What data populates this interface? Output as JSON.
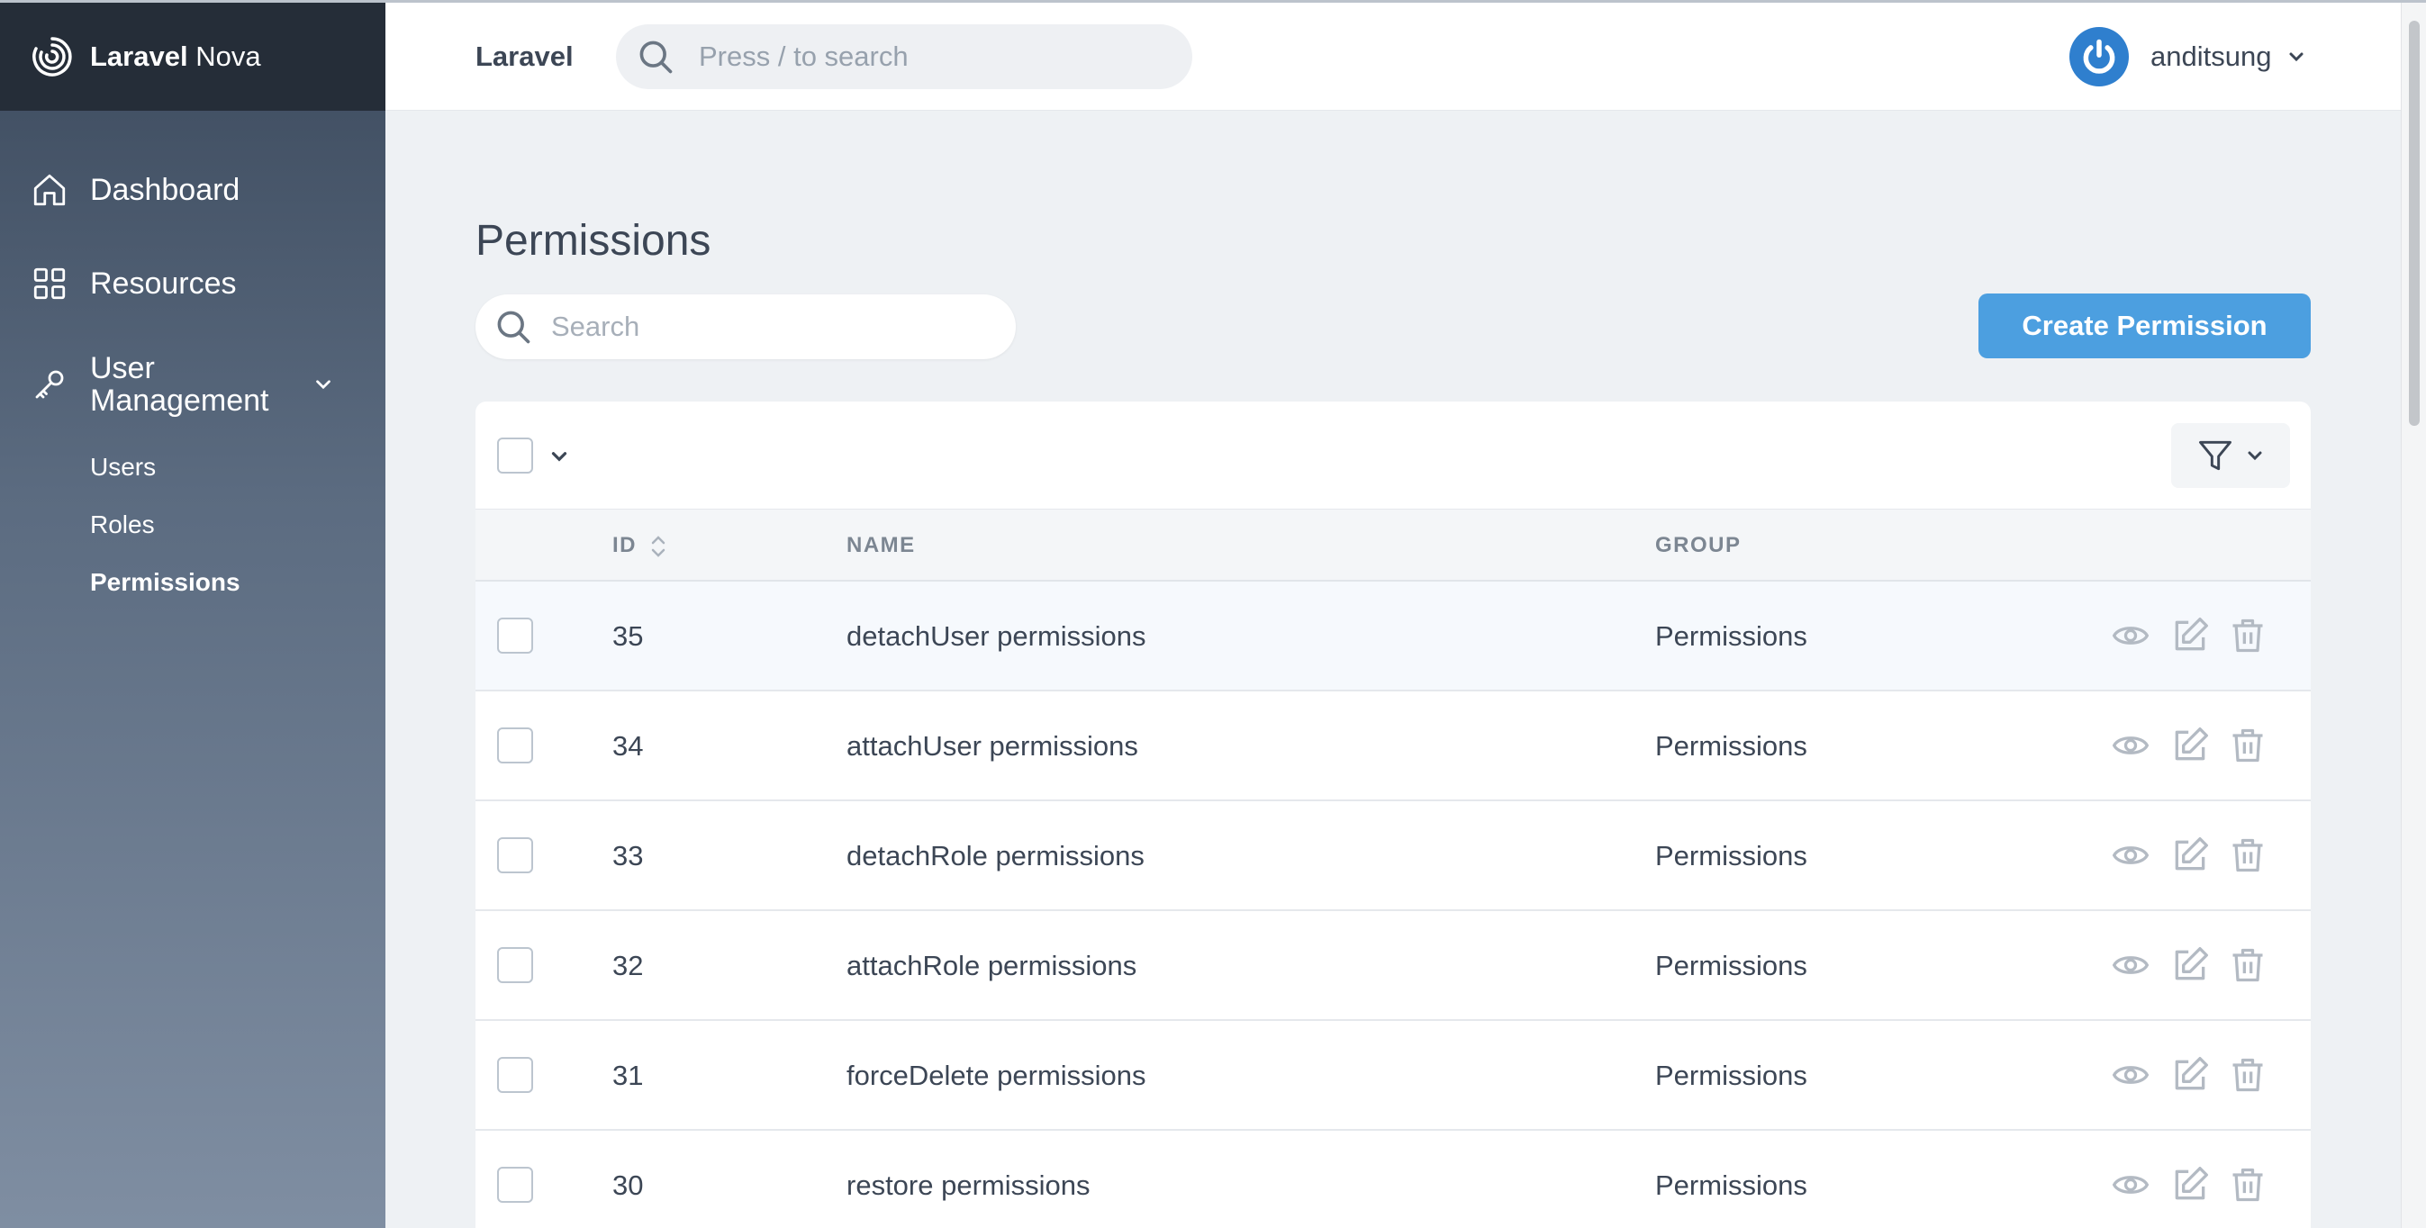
{
  "app": {
    "brand_bold": "Laravel",
    "brand_rest": " Nova"
  },
  "sidebar": {
    "items": [
      {
        "label": "Dashboard",
        "icon": "home-icon"
      },
      {
        "label": "Resources",
        "icon": "grid-icon"
      },
      {
        "label": "User Management",
        "icon": "key-icon"
      }
    ],
    "sub_items": [
      {
        "label": "Users",
        "active": false
      },
      {
        "label": "Roles",
        "active": false
      },
      {
        "label": "Permissions",
        "active": true
      }
    ]
  },
  "header": {
    "title": "Laravel",
    "search_placeholder": "Press / to search",
    "username": "anditsung"
  },
  "main": {
    "page_title": "Permissions",
    "search_placeholder": "Search",
    "create_button": "Create Permission",
    "columns": {
      "id": "ID",
      "name": "NAME",
      "group": "GROUP"
    },
    "rows": [
      {
        "id": "35",
        "name": "detachUser permissions",
        "group": "Permissions"
      },
      {
        "id": "34",
        "name": "attachUser permissions",
        "group": "Permissions"
      },
      {
        "id": "33",
        "name": "detachRole permissions",
        "group": "Permissions"
      },
      {
        "id": "32",
        "name": "attachRole permissions",
        "group": "Permissions"
      },
      {
        "id": "31",
        "name": "forceDelete permissions",
        "group": "Permissions"
      },
      {
        "id": "30",
        "name": "restore permissions",
        "group": "Permissions"
      }
    ]
  },
  "colors": {
    "accent": "#4c9fe0",
    "sidebar_top": "#252d38",
    "avatar": "#2f7fce"
  }
}
